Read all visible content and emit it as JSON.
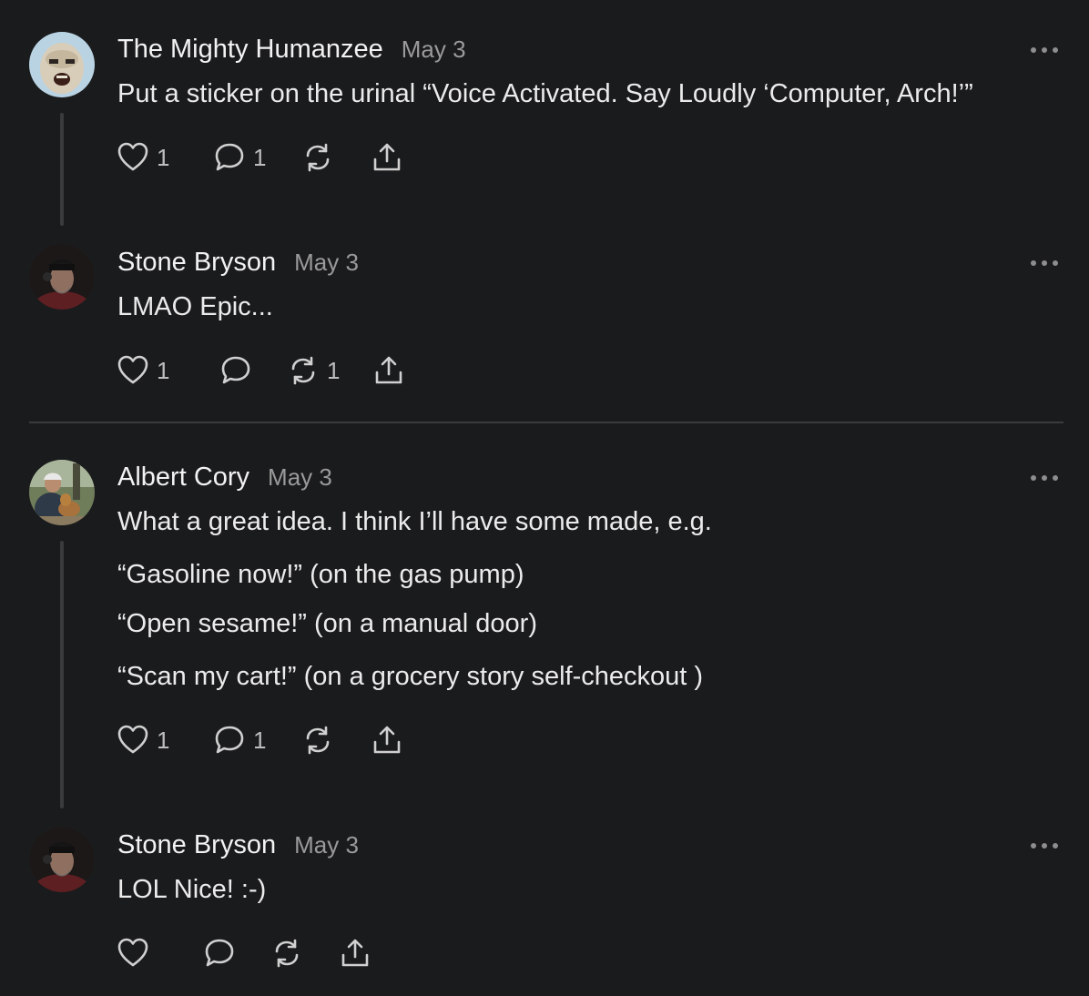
{
  "comments": [
    {
      "author": "The Mighty Humanzee",
      "date": "May 3",
      "lines": [
        "Put a sticker on the urinal “Voice Activated. Say Loudly ‘Computer, Arch!’”"
      ],
      "like_count": "1",
      "reply_count": "1",
      "restack_count": ""
    },
    {
      "author": "Stone Bryson",
      "date": "May 3",
      "lines": [
        "LMAO Epic..."
      ],
      "like_count": "1",
      "reply_count": "",
      "restack_count": "1"
    },
    {
      "author": "Albert Cory",
      "date": "May 3",
      "lines": [
        "What a great idea. I think I’ll have some made, e.g.",
        "“Gasoline now!” (on the gas pump)",
        "“Open sesame!” (on a manual door)",
        "“Scan my cart!” (on a grocery story self-checkout )"
      ],
      "like_count": "1",
      "reply_count": "1",
      "restack_count": ""
    },
    {
      "author": "Stone Bryson",
      "date": "May 3",
      "lines": [
        "LOL Nice! :-)"
      ],
      "like_count": "",
      "reply_count": "",
      "restack_count": ""
    }
  ],
  "icons": {
    "like": "heart-icon",
    "reply": "comment-bubble-icon",
    "restack": "restack-icon",
    "share": "share-icon",
    "more": "more-options-icon"
  },
  "colors": {
    "background": "#1a1b1d",
    "text": "#ebebeb",
    "muted": "#9a9a9a",
    "line": "#3a3b3d"
  }
}
